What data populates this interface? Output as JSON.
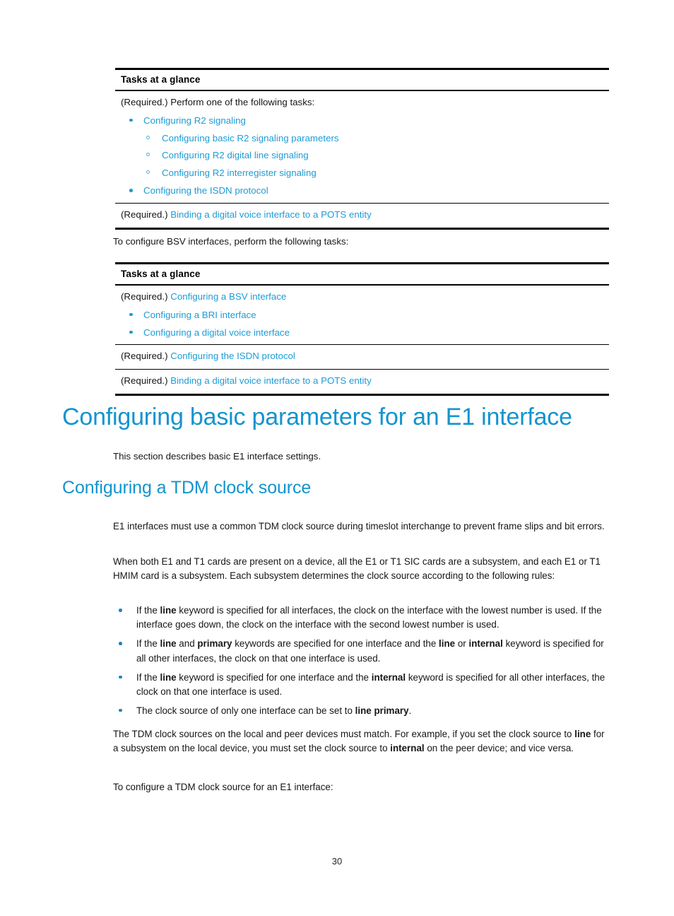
{
  "page": {
    "number": "30",
    "link_color": "#1D9CD6",
    "heading_color": "#1394CE",
    "bullet_color": "#1D84C4"
  },
  "table1": {
    "header": "Tasks at a glance",
    "row1": {
      "lead": "(Required.) Perform one of the following tasks:",
      "items": [
        {
          "level": 1,
          "label": "Configuring R2 signaling"
        },
        {
          "level": 2,
          "label": "Configuring basic R2 signaling parameters"
        },
        {
          "level": 2,
          "label": "Configuring R2 digital line signaling"
        },
        {
          "level": 2,
          "label": "Configuring R2 interregister signaling"
        },
        {
          "level": 1,
          "label": "Configuring the ISDN protocol"
        }
      ]
    },
    "row2": {
      "prefix": "(Required.) ",
      "link": "Binding a digital voice interface to a POTS entity"
    }
  },
  "intro2": "To configure BSV interfaces, perform the following tasks:",
  "table2": {
    "header": "Tasks at a glance",
    "row1": {
      "prefix": "(Required.) ",
      "link": "Configuring a BSV interface",
      "items": [
        {
          "level": 1,
          "label": "Configuring a BRI interface"
        },
        {
          "level": 1,
          "label": "Configuring a digital voice interface"
        }
      ]
    },
    "row2": {
      "prefix": "(Required.) ",
      "link": "Configuring the ISDN protocol"
    },
    "row3": {
      "prefix": "(Required.) ",
      "link": "Binding a digital voice interface to a POTS entity"
    }
  },
  "section": {
    "h1": "Configuring basic parameters for an E1 interface",
    "h1_intro": "This section describes basic E1 interface settings.",
    "h2": "Configuring a TDM clock source",
    "para1": "E1 interfaces must use a common TDM clock source during timeslot interchange to prevent frame slips and bit errors.",
    "para2": "When both E1 and T1 cards are present on a device, all the E1 or T1 SIC cards are a subsystem, and each E1 or T1 HMIM card is a subsystem. Each subsystem determines the clock source according to the following rules:",
    "rules": [
      {
        "p1": "If the ",
        "b1": "line",
        "p2": " keyword is specified for all interfaces, the clock on the interface with the lowest number is used. If the interface goes down, the clock on the interface with the second lowest number is used."
      },
      {
        "p1": "If the ",
        "b1": "line",
        "p2": " and ",
        "b2": "primary",
        "p3": " keywords are specified for one interface and the ",
        "b3": "line",
        "p4": " or ",
        "b4": "internal",
        "p5": " keyword is specified for all other interfaces, the clock on that one interface is used."
      },
      {
        "p1": "If the ",
        "b1": "line",
        "p2": " keyword is specified for one interface and the ",
        "b2": "internal",
        "p3": " keyword is specified for all other interfaces, the clock on that one interface is used."
      },
      {
        "p1": "The clock source of only one interface can be set to ",
        "b1": "line primary",
        "p2": "."
      }
    ],
    "para3_a": "The TDM clock sources on the local and peer devices must match. For example, if you set the clock source to ",
    "para3_b": "line",
    "para3_c": " for a subsystem on the local device, you must set the clock source to ",
    "para3_d": "internal",
    "para3_e": " on the peer device; and vice versa.",
    "para4": "To configure a TDM clock source for an E1 interface:"
  }
}
